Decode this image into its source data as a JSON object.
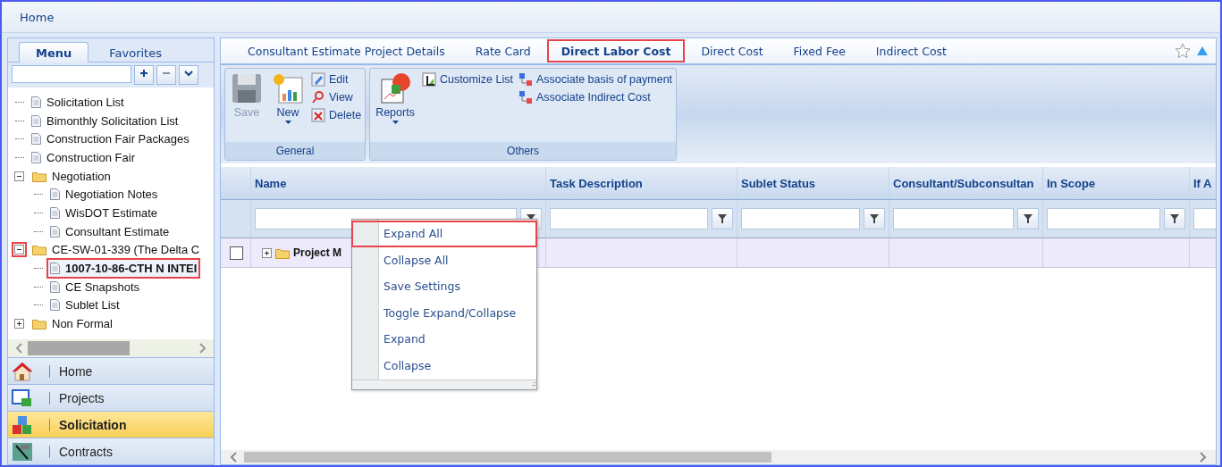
{
  "header": {
    "title": "Home"
  },
  "left_panel": {
    "tabs": [
      {
        "label": "Menu",
        "selected": true
      },
      {
        "label": "Favorites",
        "selected": false
      }
    ],
    "search": {
      "buttons": [
        {
          "kind": "expand"
        },
        {
          "kind": "collapse"
        },
        {
          "kind": "dropdown"
        }
      ]
    },
    "tree": [
      {
        "label": "Solicitation List",
        "kind": "doc",
        "selected": false,
        "highlighted": false
      },
      {
        "label": "Bimonthly Solicitation List",
        "kind": "doc",
        "selected": false,
        "highlighted": false
      },
      {
        "label": "Construction Fair Packages",
        "kind": "doc",
        "selected": false,
        "highlighted": false
      },
      {
        "label": "Construction Fair",
        "kind": "doc",
        "selected": false,
        "highlighted": false
      },
      {
        "label": "Negotiation",
        "kind": "folder",
        "expanded": true,
        "selected": false,
        "highlighted": false,
        "children": [
          {
            "label": "Negotiation Notes",
            "kind": "doc",
            "selected": false,
            "highlighted": false
          },
          {
            "label": "WisDOT Estimate",
            "kind": "doc",
            "selected": false,
            "highlighted": false
          },
          {
            "label": "Consultant Estimate",
            "kind": "doc",
            "selected": false,
            "highlighted": false
          }
        ]
      },
      {
        "label": "CE-SW-01-339 (The Delta C",
        "kind": "folder",
        "expanded": true,
        "selected": false,
        "highlighted": false,
        "toggle_highlighted": true,
        "children": [
          {
            "label": "1007-10-86-CTH N INTEI",
            "kind": "doc",
            "selected": true,
            "highlighted": true
          },
          {
            "label": "CE Snapshots",
            "kind": "doc",
            "selected": false,
            "highlighted": false
          },
          {
            "label": "Sublet List",
            "kind": "doc",
            "selected": false,
            "highlighted": false
          }
        ]
      },
      {
        "label": "Non Formal",
        "kind": "folder",
        "expanded": false,
        "selected": false,
        "highlighted": false
      }
    ],
    "nav": [
      {
        "label": "Home",
        "kind": "home",
        "selected": false
      },
      {
        "label": "Projects",
        "kind": "projects",
        "selected": false
      },
      {
        "label": "Solicitation",
        "kind": "solicitation",
        "selected": true
      },
      {
        "label": "Contracts",
        "kind": "contracts",
        "selected": false
      }
    ]
  },
  "tabs": [
    {
      "label": "Consultant Estimate Project Details",
      "selected": false,
      "highlighted": false
    },
    {
      "label": "Rate Card",
      "selected": false,
      "highlighted": false
    },
    {
      "label": "Direct Labor Cost",
      "selected": true,
      "highlighted": true
    },
    {
      "label": "Direct Cost",
      "selected": false,
      "highlighted": false
    },
    {
      "label": "Fixed Fee",
      "selected": false,
      "highlighted": false
    },
    {
      "label": "Indirect Cost",
      "selected": false,
      "highlighted": false
    }
  ],
  "ribbon": {
    "groups": [
      {
        "title": "General",
        "large": [
          {
            "label": "Save",
            "kind": "save",
            "disabled": true,
            "dropdown": false
          },
          {
            "label": "New",
            "kind": "new",
            "disabled": false,
            "dropdown": true
          }
        ],
        "small": [
          [
            {
              "label": "Edit",
              "kind": "edit"
            },
            {
              "label": "View",
              "kind": "view"
            },
            {
              "label": "Delete",
              "kind": "delete"
            }
          ]
        ]
      },
      {
        "title": "Others",
        "large": [
          {
            "label": "Reports",
            "kind": "reports",
            "disabled": false,
            "dropdown": true
          }
        ],
        "small": [
          [
            {
              "label": "Customize List",
              "kind": "customize"
            }
          ],
          [
            {
              "label": "Associate basis of payment",
              "kind": "associate"
            },
            {
              "label": "Associate Indirect Cost",
              "kind": "associate"
            }
          ]
        ]
      }
    ]
  },
  "grid": {
    "columns": [
      "Name",
      "Task Description",
      "Sublet Status",
      "Consultant/Subconsultan",
      "In Scope",
      "If A"
    ],
    "rows": [
      {
        "checked": false,
        "name": "Project M",
        "expanded": false
      }
    ]
  },
  "context_menu": {
    "items": [
      {
        "label": "Expand All",
        "highlighted": true
      },
      {
        "label": "Collapse All",
        "highlighted": false
      },
      {
        "label": "Save Settings",
        "highlighted": false
      },
      {
        "label": "Toggle Expand/Collapse",
        "highlighted": false
      },
      {
        "label": "Expand",
        "highlighted": false
      },
      {
        "label": "Collapse",
        "highlighted": false
      }
    ]
  }
}
